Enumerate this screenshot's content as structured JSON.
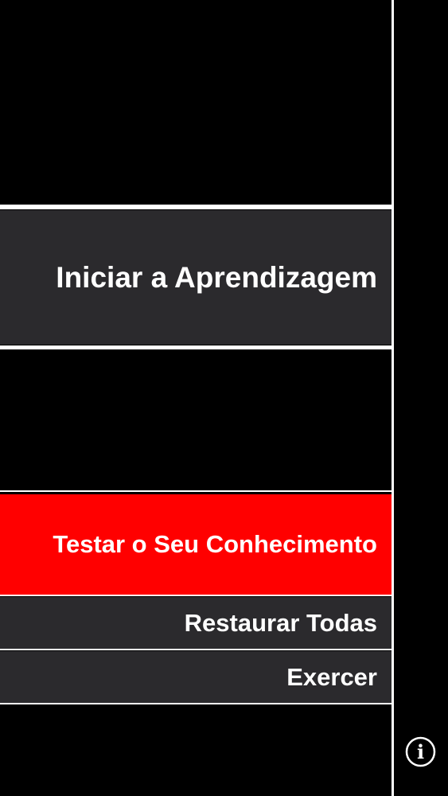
{
  "menu": {
    "learn_label": "Iniciar a Aprendizagem",
    "test_label": "Testar o Seu Conhecimento",
    "reset_label": "Restaurar Todas",
    "exercise_label": "Exercer"
  },
  "info": {
    "icon": "info-icon",
    "glyph": "i"
  },
  "colors": {
    "background": "#000000",
    "button_dark": "#2b2a2d",
    "button_accent": "#ff0000",
    "text": "#ffffff",
    "divider": "#ffffff"
  }
}
